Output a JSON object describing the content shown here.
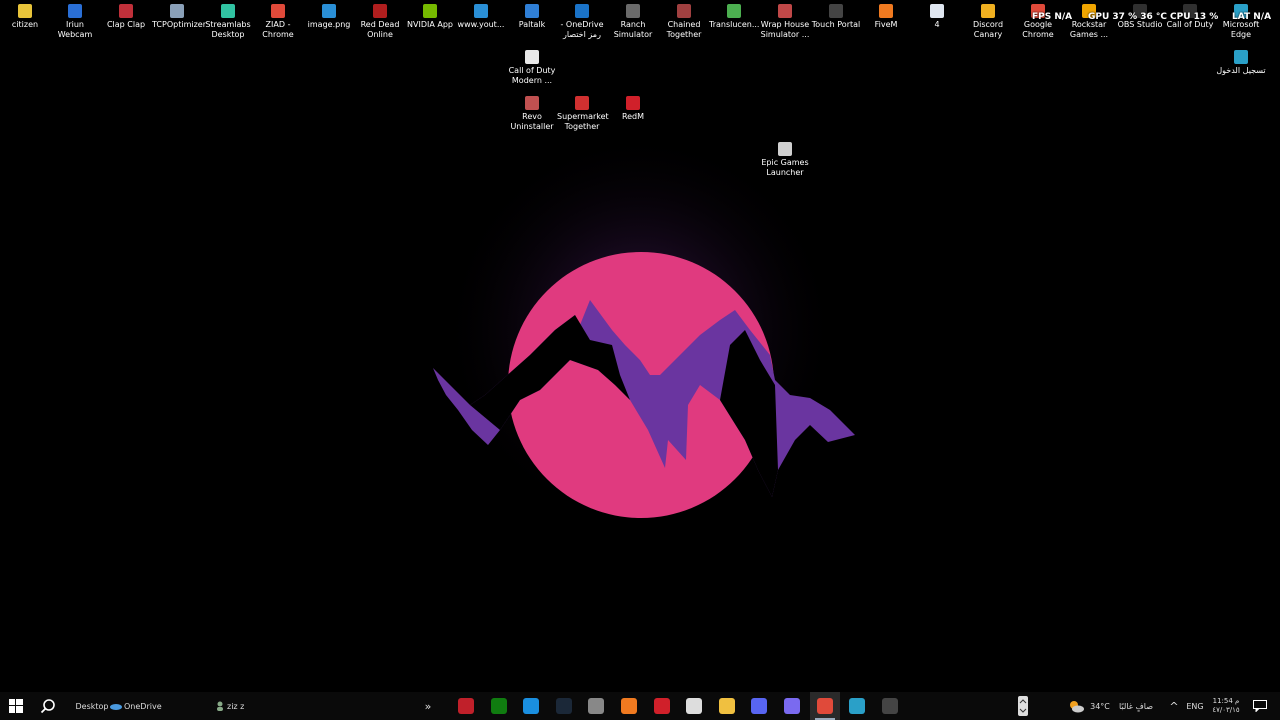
{
  "desktop_icons": [
    {
      "label": "citizen",
      "color": "#e8c43a"
    },
    {
      "label": "Iriun Webcam",
      "color": "#2a6fd6"
    },
    {
      "label": "Clap Clap",
      "color": "#c0303a"
    },
    {
      "label": "TCPOptimizer",
      "color": "#8aa0b8"
    },
    {
      "label": "Streamlabs Desktop",
      "color": "#31c3a2"
    },
    {
      "label": "ZIAD - Chrome",
      "color": "#e04a3a"
    },
    {
      "label": "image.png",
      "color": "#2a8fd6"
    },
    {
      "label": "Red Dead Online",
      "color": "#b01e1e"
    },
    {
      "label": "NVIDIA App",
      "color": "#76b900"
    },
    {
      "label": "www.yout...",
      "color": "#2a8fd6"
    },
    {
      "label": "Paltalk",
      "color": "#2f7fd6"
    },
    {
      "label": "- OneDrive رمز اختصار",
      "color": "#1a73c8"
    },
    {
      "label": "Ranch Simulator",
      "color": "#6a6a6a"
    },
    {
      "label": "Chained Together",
      "color": "#a04040"
    },
    {
      "label": "Translucen...",
      "color": "#4caf50"
    },
    {
      "label": "Wrap House Simulator ...",
      "color": "#c04848"
    },
    {
      "label": "Touch Portal",
      "color": "#444"
    },
    {
      "label": "FiveM",
      "color": "#f07a20"
    },
    {
      "label": "4",
      "color": "#dfe6f0"
    },
    {
      "label": "Discord Canary",
      "color": "#f0b020"
    },
    {
      "label": "Google Chrome",
      "color": "#e04a3a"
    },
    {
      "label": "Rockstar Games ...",
      "color": "#f0a500"
    },
    {
      "label": "OBS Studio",
      "color": "#303030"
    },
    {
      "label": "Call of Duty",
      "color": "#303030"
    },
    {
      "label": "Microsoft Edge",
      "color": "#2aa0c8"
    },
    {
      "label": "Call of Duty Modern ...",
      "color": "#e8e8e8"
    },
    {
      "label": "تسجيل الدخول",
      "color": "#2aa0c8"
    },
    {
      "label": "Revo Uninstaller",
      "color": "#c05050"
    },
    {
      "label": "Supermarket Together",
      "color": "#d03030"
    },
    {
      "label": "RedM",
      "color": "#d0202a"
    },
    {
      "label": "Epic Games Launcher",
      "color": "#d0d0d0"
    }
  ],
  "overlay": {
    "fps": "FPS  N/A",
    "gpu": "GPU  37 %  36 °C",
    "cpu": "CPU  13 %",
    "lat": "LAT  N/A"
  },
  "taskbar": {
    "start_icon": "windows-logo-icon",
    "search_icon": "search-icon",
    "desktop_label": "Desktop",
    "onedrive_label": "OneDrive",
    "user_label": "ziz z",
    "overflow_chevron": "»",
    "apps": [
      {
        "name": "media-player",
        "color": "#c0202a"
      },
      {
        "name": "xbox",
        "color": "#107c10"
      },
      {
        "name": "battle-net",
        "color": "#1a8fe0"
      },
      {
        "name": "steam",
        "color": "#1b2838"
      },
      {
        "name": "settings",
        "color": "#888"
      },
      {
        "name": "fivem",
        "color": "#f07a20"
      },
      {
        "name": "redm",
        "color": "#d0202a"
      },
      {
        "name": "store",
        "color": "#ddd"
      },
      {
        "name": "file-explorer",
        "color": "#f0c040"
      },
      {
        "name": "discord",
        "color": "#5865f2"
      },
      {
        "name": "copilot",
        "color": "#7a6af0"
      },
      {
        "name": "chrome",
        "color": "#e04a3a"
      },
      {
        "name": "edge",
        "color": "#2aa0c8"
      },
      {
        "name": "obs",
        "color": "#444"
      }
    ],
    "weather_temp": "34°C",
    "weather_text": "صافٍ غالبًا",
    "tray_chevron": "^",
    "language": "ENG",
    "time": "11:54 م",
    "date": "٤٧/٠٣/١٥",
    "notification_icon": "notification-icon"
  }
}
